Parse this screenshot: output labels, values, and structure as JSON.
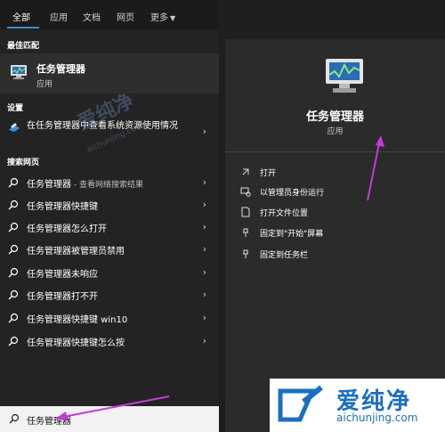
{
  "tabs": [
    {
      "label": "全部"
    },
    {
      "label": "应用"
    },
    {
      "label": "文档"
    },
    {
      "label": "网页"
    },
    {
      "label": "更多"
    }
  ],
  "sections": {
    "best_match": "最佳匹配",
    "settings": "设置",
    "search_web": "搜索网页"
  },
  "best_match": {
    "title": "任务管理器",
    "subtitle": "应用"
  },
  "settings_item": {
    "label": "在任务管理器中查看系统资源使用情况"
  },
  "web_results": [
    {
      "text": "任务管理器",
      "suffix": " - 查看网络搜索结果"
    },
    {
      "text": "任务管理器快捷键",
      "suffix": ""
    },
    {
      "text": "任务管理器怎么打开",
      "suffix": ""
    },
    {
      "text": "任务管理器被管理员禁用",
      "suffix": ""
    },
    {
      "text": "任务管理器未响应",
      "suffix": ""
    },
    {
      "text": "任务管理器打不开",
      "suffix": ""
    },
    {
      "text": "任务管理器快捷键 win10",
      "suffix": ""
    },
    {
      "text": "任务管理器快捷键怎么按",
      "suffix": ""
    }
  ],
  "search_box": {
    "value": "任务管理器"
  },
  "preview": {
    "title": "任务管理器",
    "subtitle": "应用",
    "actions": [
      {
        "label": "打开",
        "icon": "open-icon"
      },
      {
        "label": "以管理员身份运行",
        "icon": "shield-icon"
      },
      {
        "label": "打开文件位置",
        "icon": "file-location-icon"
      },
      {
        "label": "固定到\"开始\"屏幕",
        "icon": "pin-icon"
      },
      {
        "label": "固定到任务栏",
        "icon": "pin-icon"
      }
    ]
  },
  "logo": {
    "text": "爱纯净",
    "url": "aichunjing.com"
  },
  "watermark": {
    "text": "爱纯净",
    "url": "aichunjing.com"
  },
  "colors": {
    "accent": "#3b8fd9",
    "annotation_arrow": "#c13cd6",
    "logo_blue": "#1a6fc1"
  }
}
